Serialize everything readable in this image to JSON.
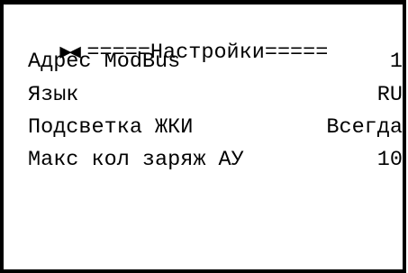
{
  "screen": {
    "nav_icon": "left-right-triangles-icon",
    "title": "=====Настройки====="
  },
  "settings": [
    {
      "label": "Адрес ModBus",
      "value": "1"
    },
    {
      "label": "Язык",
      "value": "RU"
    },
    {
      "label": "Подсветка ЖКИ",
      "value": "Всегда"
    },
    {
      "label": "Макс кол заряж АУ",
      "value": "10"
    }
  ],
  "colors": {
    "background": "#ffffff",
    "text": "#000000",
    "border": "#000000"
  }
}
